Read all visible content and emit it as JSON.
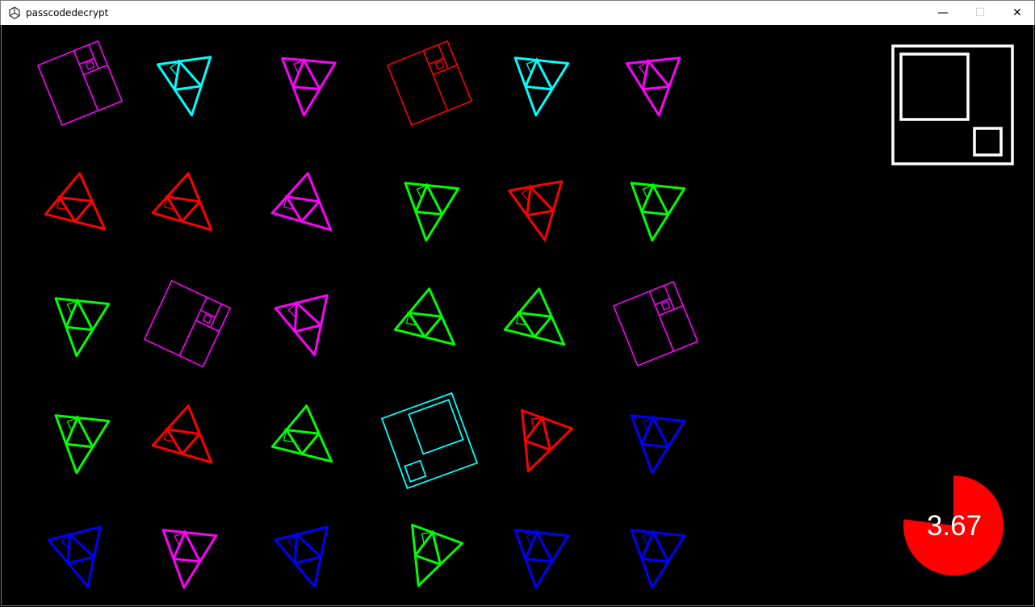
{
  "window": {
    "title": "passcodedecrypt",
    "minimize_glyph": "—",
    "maximize_glyph": "☐",
    "close_glyph": "✕"
  },
  "colors": {
    "magenta": "#ff00ff",
    "cyan": "#00ffff",
    "red": "#ff0000",
    "green": "#00ff00",
    "blue": "#0000ff",
    "white": "#ffffff"
  },
  "grid": {
    "rows": [
      [
        {
          "shape": "square",
          "color": "magenta"
        },
        {
          "shape": "triangle",
          "color": "cyan"
        },
        {
          "shape": "triangle",
          "color": "magenta"
        },
        {
          "shape": "square",
          "color": "red"
        },
        {
          "shape": "triangle",
          "color": "cyan"
        },
        {
          "shape": "triangle",
          "color": "magenta"
        }
      ],
      [
        {
          "shape": "triangle",
          "color": "red"
        },
        {
          "shape": "triangle",
          "color": "red"
        },
        {
          "shape": "triangle",
          "color": "magenta"
        },
        {
          "shape": "triangle",
          "color": "green"
        },
        {
          "shape": "triangle",
          "color": "red"
        },
        {
          "shape": "triangle",
          "color": "green"
        }
      ],
      [
        {
          "shape": "triangle",
          "color": "green"
        },
        {
          "shape": "square",
          "color": "magenta"
        },
        {
          "shape": "triangle",
          "color": "magenta"
        },
        {
          "shape": "triangle",
          "color": "green"
        },
        {
          "shape": "triangle",
          "color": "green"
        },
        {
          "shape": "square",
          "color": "magenta"
        }
      ],
      [
        {
          "shape": "triangle",
          "color": "green"
        },
        {
          "shape": "triangle",
          "color": "red"
        },
        {
          "shape": "triangle",
          "color": "green"
        },
        {
          "shape": "target-square",
          "color": "cyan"
        },
        {
          "shape": "triangle",
          "color": "red"
        },
        {
          "shape": "triangle",
          "color": "blue"
        }
      ],
      [
        {
          "shape": "triangle",
          "color": "blue"
        },
        {
          "shape": "triangle",
          "color": "magenta"
        },
        {
          "shape": "triangle",
          "color": "blue"
        },
        {
          "shape": "triangle",
          "color": "green"
        },
        {
          "shape": "triangle",
          "color": "blue"
        },
        {
          "shape": "triangle",
          "color": "blue"
        }
      ]
    ]
  },
  "target_preview": {
    "shape": "target-square",
    "color": "white"
  },
  "timer": {
    "value_text": "3.67",
    "remaining_fraction": 0.77,
    "color": "#ff0000"
  }
}
